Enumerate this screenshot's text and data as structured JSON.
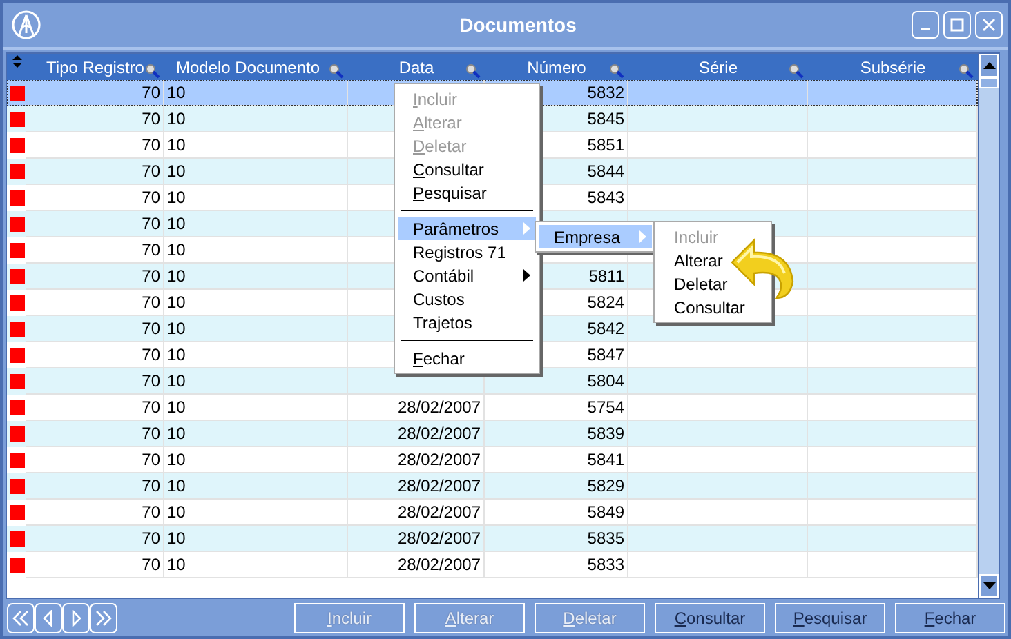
{
  "window": {
    "title": "Documentos"
  },
  "table": {
    "columns": [
      "Tipo Registro",
      "Modelo Documento",
      "Data",
      "Número",
      "Série",
      "Subsérie"
    ],
    "rows": [
      {
        "tipo": "70",
        "modelo": "10",
        "numero": "5832",
        "selected": true
      },
      {
        "tipo": "70",
        "modelo": "10",
        "numero": "5845",
        "selected": false
      },
      {
        "tipo": "70",
        "modelo": "10",
        "numero": "5851",
        "selected": false
      },
      {
        "tipo": "70",
        "modelo": "10",
        "numero": "5844",
        "selected": false
      },
      {
        "tipo": "70",
        "modelo": "10",
        "numero": "5843",
        "selected": false
      },
      {
        "tipo": "70",
        "modelo": "10",
        "selected": false
      },
      {
        "tipo": "70",
        "modelo": "10",
        "selected": false
      },
      {
        "tipo": "70",
        "modelo": "10",
        "numero": "5811",
        "selected": false
      },
      {
        "tipo": "70",
        "modelo": "10",
        "numero": "5824",
        "selected": false
      },
      {
        "tipo": "70",
        "modelo": "10",
        "numero": "5842",
        "selected": false
      },
      {
        "tipo": "70",
        "modelo": "10",
        "numero": "5847",
        "selected": false
      },
      {
        "tipo": "70",
        "modelo": "10",
        "numero": "5804",
        "selected": false
      },
      {
        "tipo": "70",
        "modelo": "10",
        "data": "28/02/2007",
        "numero": "5754",
        "selected": false
      },
      {
        "tipo": "70",
        "modelo": "10",
        "data": "28/02/2007",
        "numero": "5839",
        "selected": false
      },
      {
        "tipo": "70",
        "modelo": "10",
        "data": "28/02/2007",
        "numero": "5841",
        "selected": false
      },
      {
        "tipo": "70",
        "modelo": "10",
        "data": "28/02/2007",
        "numero": "5829",
        "selected": false
      },
      {
        "tipo": "70",
        "modelo": "10",
        "data": "28/02/2007",
        "numero": "5849",
        "selected": false
      },
      {
        "tipo": "70",
        "modelo": "10",
        "data": "28/02/2007",
        "numero": "5835",
        "selected": false
      },
      {
        "tipo": "70",
        "modelo": "10",
        "data": "28/02/2007",
        "numero": "5833",
        "selected": false
      }
    ]
  },
  "context_menu": {
    "items": [
      {
        "kind": "item",
        "label": "Incluir",
        "disabled": true,
        "selected": false,
        "submenu": false
      },
      {
        "kind": "item",
        "label": "Alterar",
        "disabled": true,
        "selected": false,
        "submenu": false
      },
      {
        "kind": "item",
        "label": "Deletar",
        "disabled": true,
        "selected": false,
        "submenu": false
      },
      {
        "kind": "item",
        "label": "Consultar",
        "disabled": false,
        "selected": false,
        "submenu": false
      },
      {
        "kind": "item",
        "label": "Pesquisar",
        "disabled": false,
        "selected": false,
        "submenu": false
      },
      {
        "kind": "separator"
      },
      {
        "kind": "item",
        "label": "Parâmetros",
        "disabled": false,
        "selected": true,
        "submenu": true
      },
      {
        "kind": "item",
        "label": "Registros 71",
        "disabled": false,
        "selected": false,
        "submenu": false
      },
      {
        "kind": "item",
        "label": "Contábil",
        "disabled": false,
        "selected": false,
        "submenu": true
      },
      {
        "kind": "item",
        "label": "Custos",
        "disabled": false,
        "selected": false,
        "submenu": false
      },
      {
        "kind": "item",
        "label": "Trajetos",
        "disabled": false,
        "selected": false,
        "submenu": false
      },
      {
        "kind": "separator"
      },
      {
        "kind": "item",
        "label": "Fechar",
        "disabled": false,
        "selected": false,
        "submenu": false
      }
    ]
  },
  "submenu": {
    "items": [
      {
        "label": "Empresa",
        "selected": true,
        "submenu": true
      }
    ]
  },
  "submenu_2": {
    "items": [
      {
        "label": "Incluir",
        "disabled": true
      },
      {
        "label": "Alterar",
        "disabled": false
      },
      {
        "label": "Deletar",
        "disabled": false
      },
      {
        "label": "Consultar",
        "disabled": false
      }
    ]
  },
  "footer": {
    "buttons": [
      {
        "label": "Incluir",
        "disabled": true
      },
      {
        "label": "Alterar",
        "disabled": true
      },
      {
        "label": "Deletar",
        "disabled": true
      },
      {
        "label": "Consultar",
        "disabled": false
      },
      {
        "label": "Pesquisar",
        "disabled": false
      },
      {
        "label": "Fechar",
        "disabled": false
      }
    ]
  }
}
